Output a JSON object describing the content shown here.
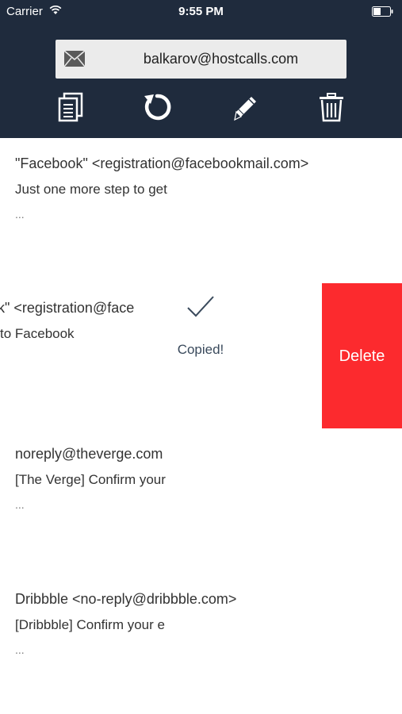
{
  "status_bar": {
    "carrier": "Carrier",
    "time": "9:55 PM"
  },
  "header": {
    "email": "balkarov@hostcalls.com",
    "icons": [
      "mail-icon",
      "copy-icon",
      "refresh-icon",
      "edit-icon",
      "trash-icon"
    ],
    "background_color": "#1f2b3d"
  },
  "messages": [
    {
      "sender": "\"Facebook\" <registration@facebookmail.com>",
      "subject": "Just one more step to get",
      "preview": "..."
    },
    {
      "sender": "k\" <registration@face",
      "subject": "to Facebook",
      "preview": ""
    },
    {
      "sender": "noreply@theverge.com",
      "subject": "[The Verge] Confirm your",
      "preview": "..."
    },
    {
      "sender": "Dribbble <no-reply@dribbble.com>",
      "subject": "[Dribbble] Confirm your e",
      "preview": "..."
    }
  ],
  "swipe_actions": {
    "copied_label": "Copied!",
    "delete_label": "Delete",
    "delete_color": "#fc2a2e"
  }
}
